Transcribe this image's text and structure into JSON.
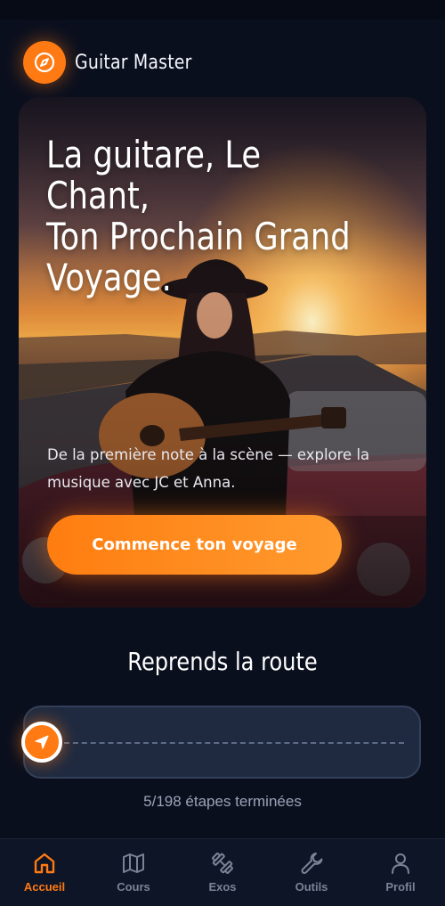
{
  "brand": {
    "name": "Guitar Master",
    "icon": "compass-icon",
    "accent": "#ff7a12"
  },
  "hero": {
    "title": "La guitare, Le Chant,\nTon Prochain Grand\nVoyage.",
    "subtitle": "De la première note à la scène — explore la musique avec JC et Anna.",
    "cta_label": "Commence ton voyage"
  },
  "progress": {
    "section_title": "Reprends la route",
    "completed": 5,
    "total": 198,
    "status_text": "5/198 étapes terminées"
  },
  "nav": {
    "items": [
      {
        "label": "Accueil",
        "icon": "home-icon",
        "active": true
      },
      {
        "label": "Cours",
        "icon": "map-icon",
        "active": false
      },
      {
        "label": "Exos",
        "icon": "dumbbell-icon",
        "active": false
      },
      {
        "label": "Outils",
        "icon": "wrench-icon",
        "active": false
      },
      {
        "label": "Profil",
        "icon": "user-icon",
        "active": false
      }
    ]
  },
  "colors": {
    "background": "#0a0f1e",
    "accent": "#ff7a12",
    "muted_text": "#9aa3b6",
    "track": "#1f2a40"
  }
}
